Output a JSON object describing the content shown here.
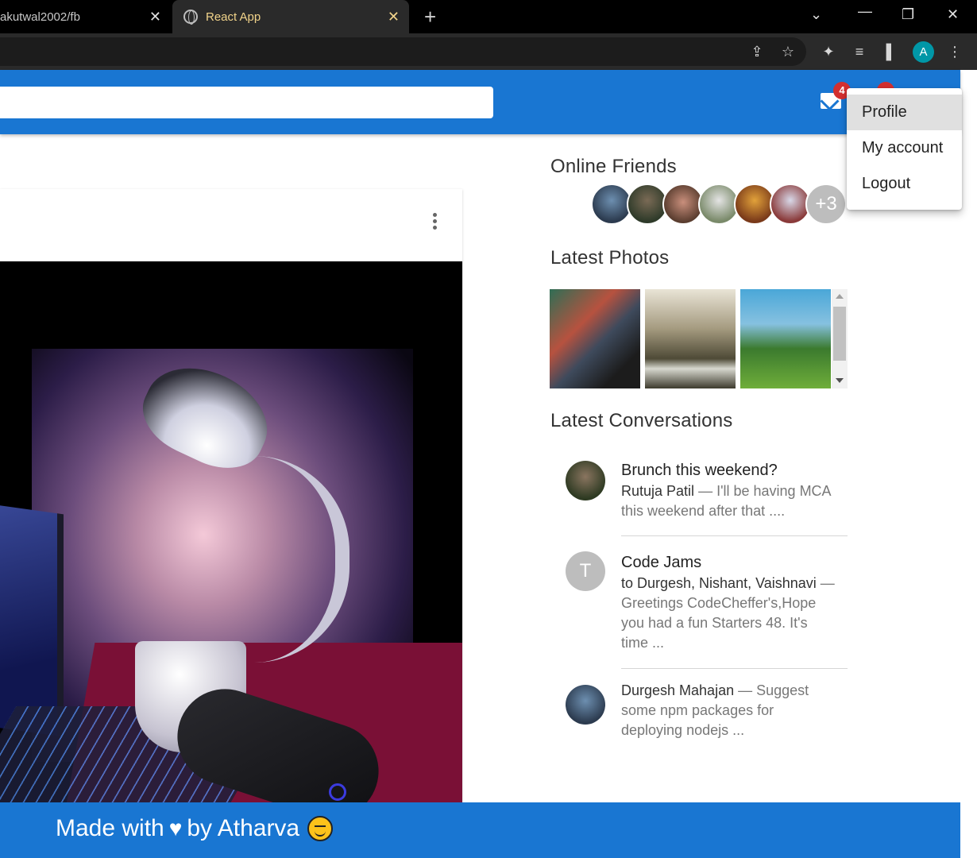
{
  "browser": {
    "tabs": [
      {
        "title": "akutwal2002/fb",
        "active": false
      },
      {
        "title": "React App",
        "active": true
      }
    ],
    "profile_initial": "A"
  },
  "appbar": {
    "mail_badge": "4"
  },
  "menu": {
    "items": [
      "Profile",
      "My account",
      "Logout"
    ],
    "selected": "Profile"
  },
  "sidebar": {
    "online_friends_title": "Online Friends",
    "online_friends_more": "+3",
    "latest_photos_title": "Latest Photos",
    "latest_conversations_title": "Latest Conversations",
    "conversations": [
      {
        "title": "Brunch this weekend?",
        "sender": "Rutuja Patil",
        "message": " — I'll be having MCA this weekend after that ...."
      },
      {
        "title": "Code Jams",
        "avatar_letter": "T",
        "sender": "to Durgesh, Nishant, Vaishnavi",
        "message": " — Greetings CodeCheffer's,Hope you had a fun Starters 48. It's time ..."
      },
      {
        "title": "",
        "sender": "Durgesh Mahajan",
        "message": " — Suggest some npm packages for deploying nodejs ..."
      }
    ]
  },
  "footer": {
    "prefix": "Made with",
    "suffix": "by Atharva"
  },
  "colors": {
    "primary": "#1976d2",
    "badge": "#d32f2f"
  }
}
